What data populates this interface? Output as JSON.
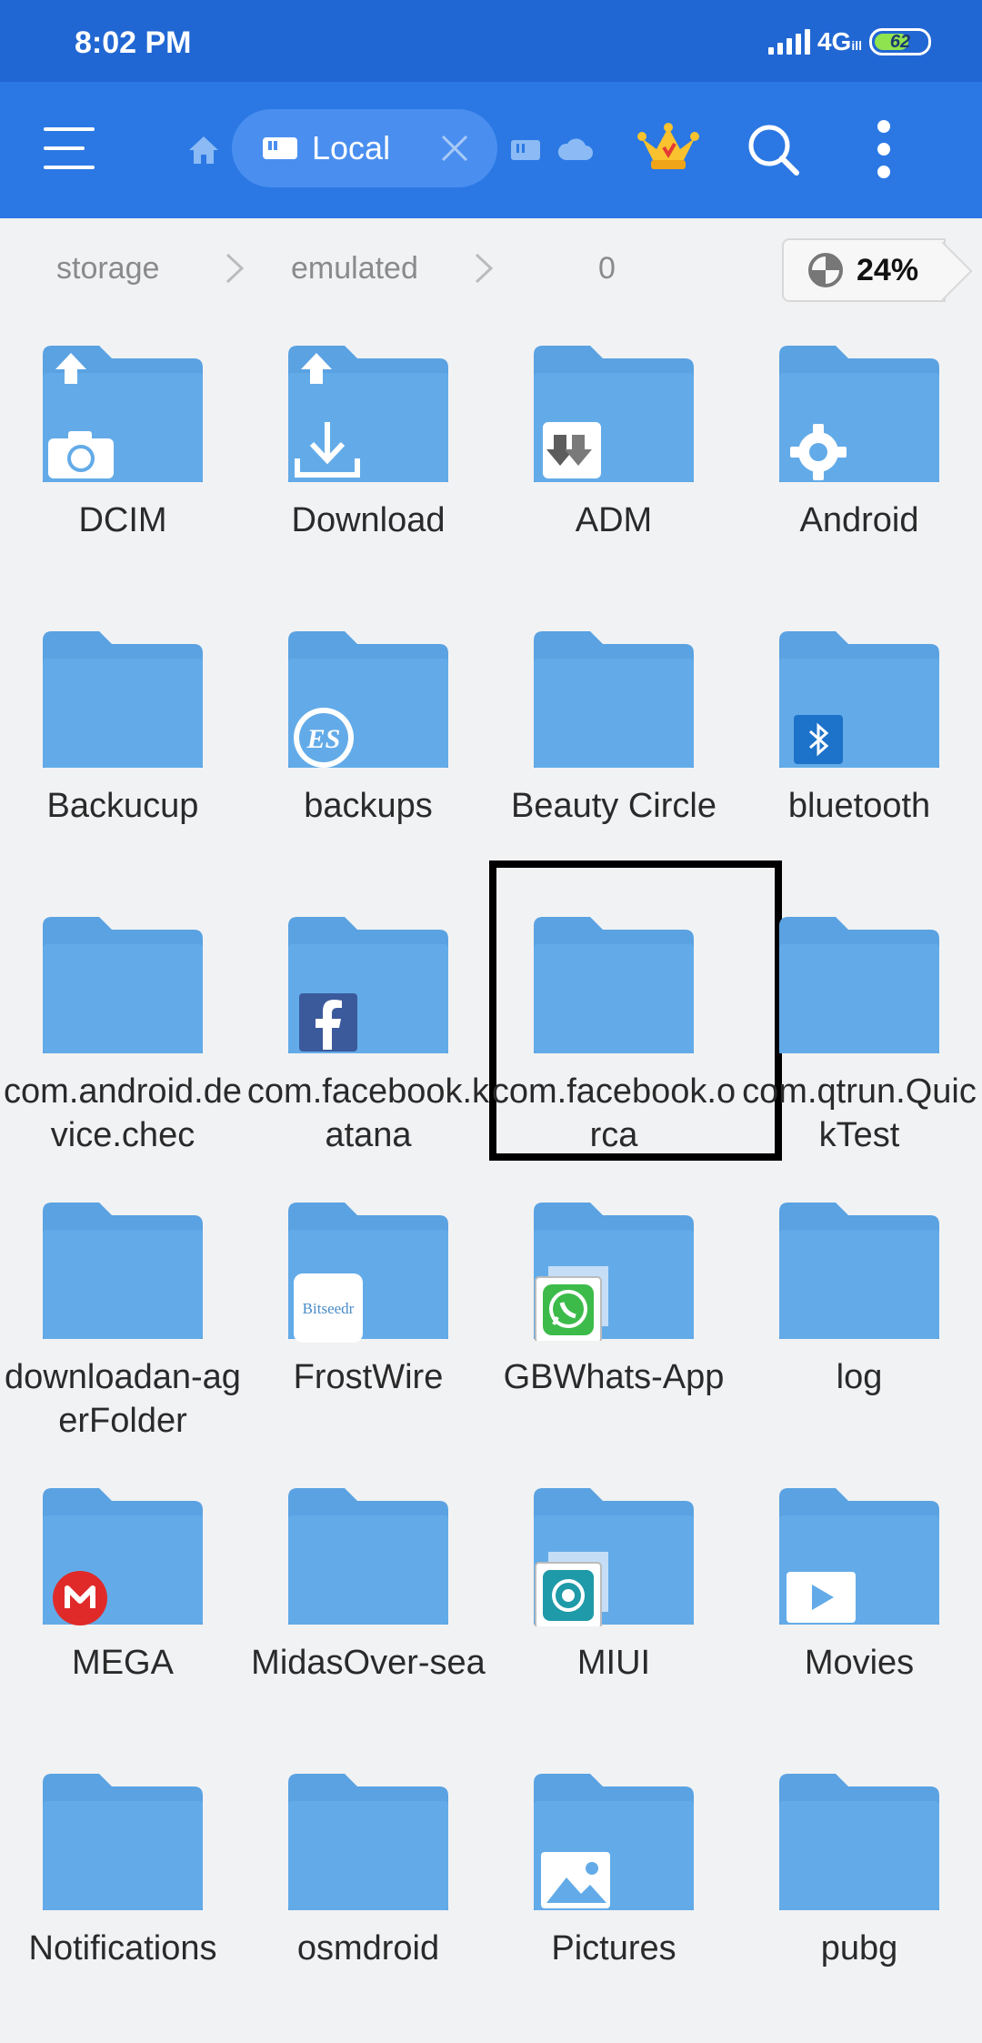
{
  "status_bar": {
    "time": "8:02 PM",
    "network": "4G",
    "network_sub": "ill",
    "battery": "62"
  },
  "app_bar": {
    "location_label": "Local",
    "icons": [
      "menu-icon",
      "home-icon",
      "phone-storage-icon",
      "close-icon",
      "sd-card-icon",
      "cloud-icon",
      "crown-icon",
      "search-icon",
      "more-icon"
    ]
  },
  "breadcrumb": {
    "items": [
      "storage",
      "emulated",
      "0"
    ],
    "storage_used": "24%"
  },
  "folders": [
    {
      "name": "DCIM",
      "overlay": "camera"
    },
    {
      "name": "Download",
      "overlay": "download"
    },
    {
      "name": "ADM",
      "overlay": "adm"
    },
    {
      "name": "Android",
      "overlay": "gear"
    },
    {
      "name": "Backucup",
      "overlay": ""
    },
    {
      "name": "backups",
      "overlay": "es"
    },
    {
      "name": "Beauty Circle",
      "overlay": ""
    },
    {
      "name": "bluetooth",
      "overlay": "bluetooth"
    },
    {
      "name": "com.android.device.chec",
      "overlay": ""
    },
    {
      "name": "com.facebook.katana",
      "overlay": "facebook"
    },
    {
      "name": "com.facebook.orca",
      "overlay": "",
      "selected": true
    },
    {
      "name": "com.qtrun.QuickTest",
      "overlay": ""
    },
    {
      "name": "downloadan-agerFolder",
      "overlay": ""
    },
    {
      "name": "FrostWire",
      "overlay": "bitseedr"
    },
    {
      "name": "GBWhats-App",
      "overlay": "whatsapp"
    },
    {
      "name": "log",
      "overlay": ""
    },
    {
      "name": "MEGA",
      "overlay": "mega"
    },
    {
      "name": "MidasOver-sea",
      "overlay": ""
    },
    {
      "name": "MIUI",
      "overlay": "miui"
    },
    {
      "name": "Movies",
      "overlay": "play"
    },
    {
      "name": "Notifications",
      "overlay": ""
    },
    {
      "name": "osmdroid",
      "overlay": ""
    },
    {
      "name": "Pictures",
      "overlay": "picture"
    },
    {
      "name": "pubg",
      "overlay": ""
    }
  ],
  "overlay_labels": {
    "bitseedr": "Bitseedr",
    "es": "ES"
  },
  "colors": {
    "status_bar": "#2167d3",
    "app_bar": "#2b78e4",
    "folder": "#63abe8",
    "folder_tab": "#5aa2e2",
    "background": "#f1f2f4"
  }
}
